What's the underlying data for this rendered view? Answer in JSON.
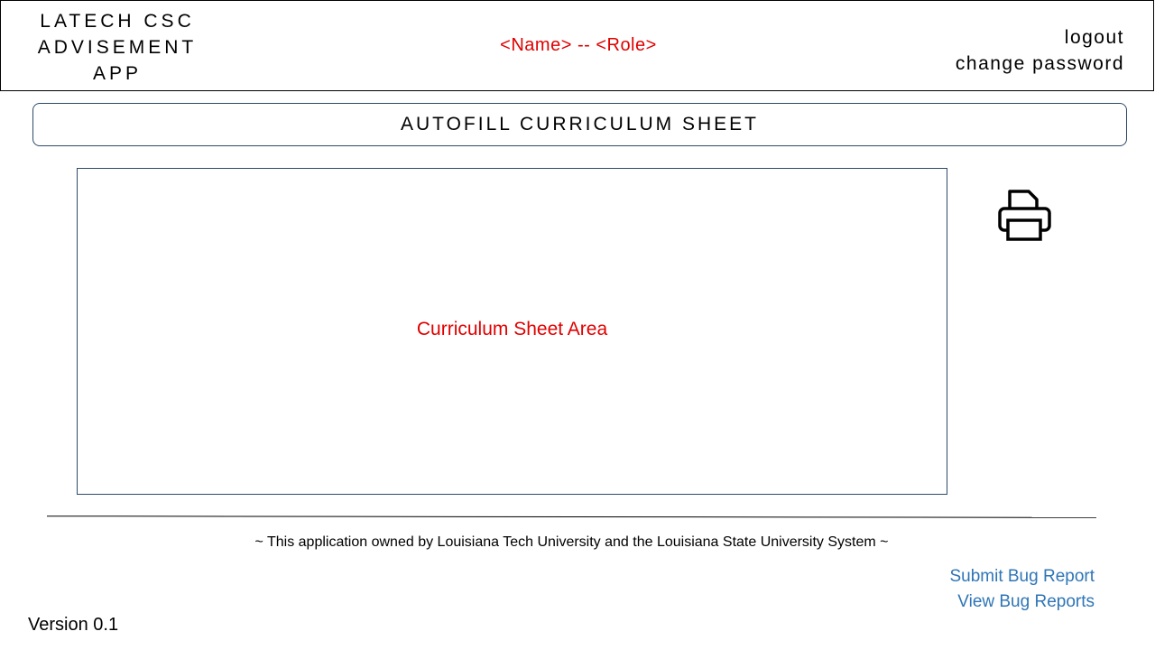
{
  "header": {
    "app_title_lines": [
      "LATECH CSC",
      "ADVISEMENT",
      "APP"
    ],
    "user_info": "<Name> -- <Role>",
    "logout_label": "logout",
    "change_password_label": "change password"
  },
  "section": {
    "title": "AUTOFILL CURRICULUM SHEET"
  },
  "main": {
    "sheet_area_label": "Curriculum Sheet Area",
    "print_icon": "printer-icon"
  },
  "footer": {
    "ownership_text": "~ This application owned by Louisiana Tech University and the Louisiana State University System ~",
    "submit_bug_label": "Submit Bug Report",
    "view_bugs_label": "View Bug Reports",
    "version": "Version 0.1"
  },
  "colors": {
    "accent_red": "#e00000",
    "link_blue": "#2e75b6",
    "border_navy": "#2e4a6b"
  }
}
